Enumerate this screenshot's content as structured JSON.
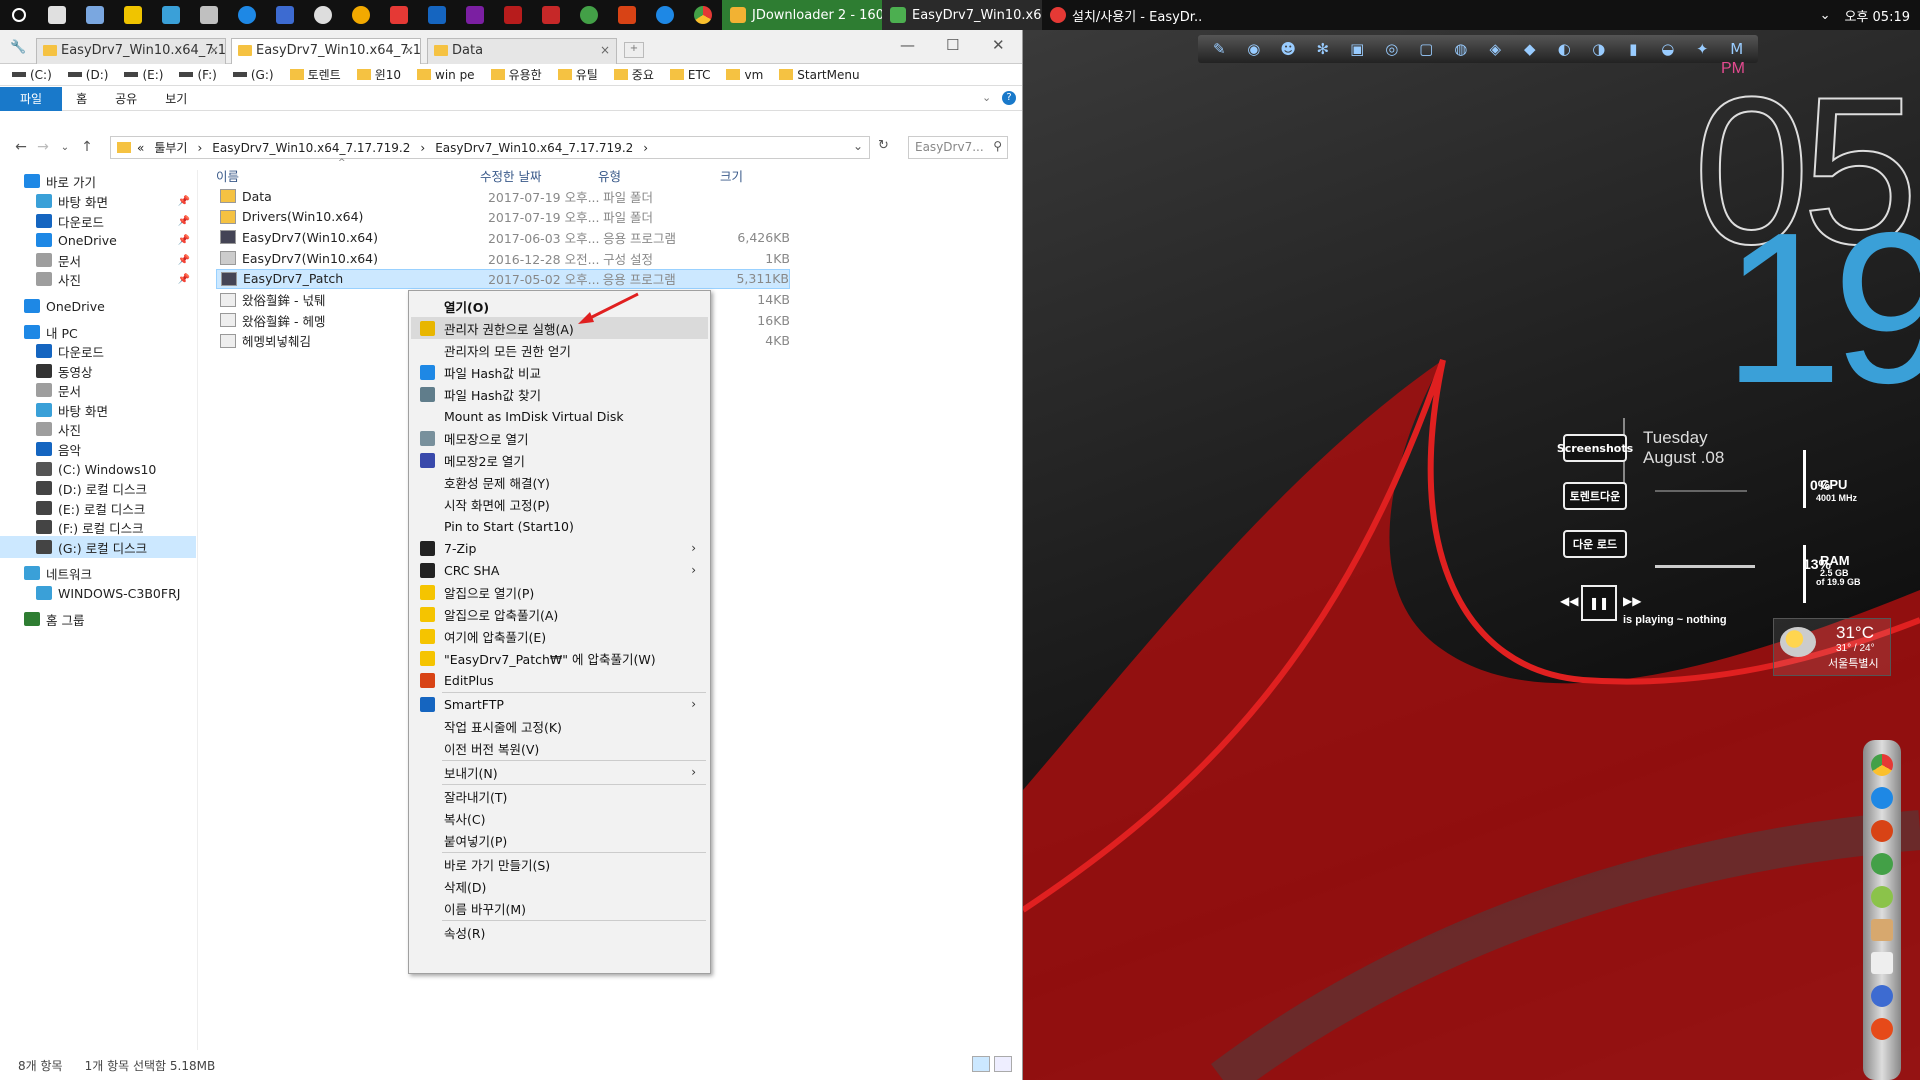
{
  "taskbar": {
    "windows": [
      {
        "label": "JDownloader 2 - 160...",
        "color": "#f2b233"
      },
      {
        "label": "EasyDrv7_Win10.x64...",
        "color": "#4caf50"
      },
      {
        "label": "설치/사용기 - EasyDr...",
        "color": "#e53935"
      }
    ],
    "tray_time": "오후 05:19"
  },
  "explorer": {
    "tabs": [
      {
        "label": "EasyDrv7_Win10.x64_7.17..."
      },
      {
        "label": "EasyDrv7_Win10.x64_7.17..."
      },
      {
        "label": "Data"
      }
    ],
    "favorites": [
      "(C:)",
      "(D:)",
      "(E:)",
      "(F:)",
      "(G:)",
      "토렌트",
      "윈10",
      "win pe",
      "유용한",
      "유틸",
      "중요",
      "ETC",
      "vm",
      "StartMenu"
    ],
    "ribbon_tabs": [
      "파일",
      "홈",
      "공유",
      "보기"
    ],
    "address": {
      "prefix": "«",
      "crumbs": [
        "툴부기",
        "EasyDrv7_Win10.x64_7.17.719.2",
        "EasyDrv7_Win10.x64_7.17.719.2"
      ]
    },
    "search_placeholder": "EasyDrv7...",
    "columns": {
      "name": "이름",
      "date": "수정한 날짜",
      "type": "유형",
      "size": "크기"
    },
    "files": [
      {
        "name": "Data",
        "date": "2017-07-19 오후...",
        "type": "파일 폴더",
        "size": "",
        "icon": "folder"
      },
      {
        "name": "Drivers(Win10.x64)",
        "date": "2017-07-19 오후...",
        "type": "파일 폴더",
        "size": "",
        "icon": "folder"
      },
      {
        "name": "EasyDrv7(Win10.x64)",
        "date": "2017-06-03 오후...",
        "type": "응용 프로그램",
        "size": "6,426KB",
        "icon": "app"
      },
      {
        "name": "EasyDrv7(Win10.x64)",
        "date": "2016-12-28 오전...",
        "type": "구성 설정",
        "size": "1KB",
        "icon": "cfg"
      },
      {
        "name": "EasyDrv7_Patch",
        "date": "2017-05-02 오후...",
        "type": "응용 프로그램",
        "size": "5,311KB",
        "icon": "app"
      },
      {
        "name": "왔俗훨鉾 - 넋퉤",
        "date": "",
        "type": "",
        "size": "14KB",
        "icon": "txt"
      },
      {
        "name": "왔俗훨鉾 - 헤멩",
        "date": "",
        "type": "",
        "size": "16KB",
        "icon": "txt"
      },
      {
        "name": "헤멩뵈넣췌김",
        "date": "",
        "type": "",
        "size": "4KB",
        "icon": "txt"
      }
    ],
    "nav": [
      {
        "label": "바로 가기",
        "indent": 0
      },
      {
        "label": "바탕 화면",
        "indent": 1,
        "pin": true
      },
      {
        "label": "다운로드",
        "indent": 1,
        "pin": true
      },
      {
        "label": "OneDrive",
        "indent": 1,
        "pin": true
      },
      {
        "label": "문서",
        "indent": 1,
        "pin": true
      },
      {
        "label": "사진",
        "indent": 1,
        "pin": true
      },
      {
        "label": "OneDrive",
        "indent": 0
      },
      {
        "label": "내 PC",
        "indent": 0
      },
      {
        "label": "다운로드",
        "indent": 1
      },
      {
        "label": "동영상",
        "indent": 1
      },
      {
        "label": "문서",
        "indent": 1
      },
      {
        "label": "바탕 화면",
        "indent": 1
      },
      {
        "label": "사진",
        "indent": 1
      },
      {
        "label": "음악",
        "indent": 1
      },
      {
        "label": "(C:) Windows10",
        "indent": 1
      },
      {
        "label": "(D:) 로컬 디스크",
        "indent": 1
      },
      {
        "label": "(E:) 로컬 디스크",
        "indent": 1
      },
      {
        "label": "(F:) 로컬 디스크",
        "indent": 1
      },
      {
        "label": "(G:) 로컬 디스크",
        "indent": 1,
        "selected": true
      },
      {
        "label": "네트워크",
        "indent": 0
      },
      {
        "label": "WINDOWS-C3B0FRJ",
        "indent": 1
      },
      {
        "label": "홈 그룹",
        "indent": 0
      }
    ],
    "status": {
      "count": "8개 항목",
      "selected": "1개 항목 선택함 5.18MB"
    }
  },
  "context_menu": {
    "items": [
      {
        "label": "열기(O)",
        "bold": true
      },
      {
        "label": "관리자 권한으로 실행(A)",
        "icon": "shield",
        "highlight": true
      },
      {
        "label": "관리자의 모든 권한 얻기"
      },
      {
        "label": "파일 Hash값 비교",
        "icon": "hash"
      },
      {
        "label": "파일 Hash값 찾기",
        "icon": "hash2"
      },
      {
        "label": "Mount as ImDisk Virtual Disk"
      },
      {
        "label": "메모장으로 열기",
        "icon": "notepad"
      },
      {
        "label": "메모장2로 열기",
        "icon": "notepad2"
      },
      {
        "label": "호환성 문제 해결(Y)"
      },
      {
        "label": "시작 화면에 고정(P)"
      },
      {
        "label": "Pin to Start (Start10)"
      },
      {
        "label": "7-Zip",
        "icon": "7z",
        "submenu": true
      },
      {
        "label": "CRC SHA",
        "icon": "7z",
        "submenu": true
      },
      {
        "label": "알집으로 열기(P)",
        "icon": "alzip"
      },
      {
        "label": "알집으로 압축풀기(A)",
        "icon": "alzip"
      },
      {
        "label": "여기에 압축풀기(E)",
        "icon": "alzip"
      },
      {
        "label": "\"EasyDrv7_Patch₩\" 에 압축풀기(W)",
        "icon": "alzip"
      },
      {
        "label": "EditPlus",
        "icon": "editplus"
      },
      {
        "sep": true
      },
      {
        "label": "SmartFTP",
        "icon": "ftp",
        "submenu": true
      },
      {
        "label": "작업 표시줄에 고정(K)"
      },
      {
        "label": "이전 버전 복원(V)"
      },
      {
        "sep": true
      },
      {
        "label": "보내기(N)",
        "submenu": true
      },
      {
        "sep": true
      },
      {
        "label": "잘라내기(T)"
      },
      {
        "label": "복사(C)"
      },
      {
        "label": "붙여넣기(P)"
      },
      {
        "sep": true
      },
      {
        "label": "바로 가기 만들기(S)"
      },
      {
        "label": "삭제(D)"
      },
      {
        "label": "이름 바꾸기(M)"
      },
      {
        "sep": true
      },
      {
        "label": "속성(R)"
      }
    ]
  },
  "desktop": {
    "clock": {
      "ampm": "PM",
      "hour": "05",
      "minute": "19"
    },
    "date": {
      "day": "Tuesday",
      "date": "August .08"
    },
    "shortcuts": [
      "Screenshots",
      "토렌트다운",
      "다운 로드"
    ],
    "cpu": {
      "label": "CPU",
      "freq": "4001 MHz",
      "value": "0%"
    },
    "ram": {
      "label": "RAM",
      "used": "2.5 GB",
      "total": "of 19.9 GB",
      "value": "13%"
    },
    "player": {
      "text": "is playing ~ nothing"
    },
    "weather": {
      "temp": "31°C",
      "range": "31° / 24°",
      "city": "서울특별시"
    }
  }
}
